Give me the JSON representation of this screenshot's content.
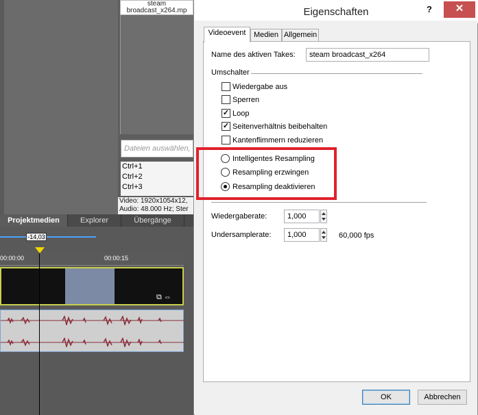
{
  "background": {
    "media_file_name_line1": "steam",
    "media_file_name_line2": "broadcast_x264.mp",
    "select_files_placeholder": "Dateien auswählen, ...",
    "shortcuts": [
      "Ctrl+1",
      "Ctrl+2",
      "Ctrl+3"
    ],
    "media_info_video": "Video: 1920x1054x12,",
    "media_info_audio": "Audio: 48.000 Hz; Ster",
    "tabs": [
      "Projektmedien",
      "Explorer",
      "Übergänge"
    ],
    "time_badge": "-14,03",
    "ruler_start": "00:00:00",
    "ruler_mark": "00:00:15"
  },
  "dialog": {
    "title": "Eigenschaften",
    "help_label": "?",
    "close_label": "✕",
    "tabs": [
      "Videoevent",
      "Medien",
      "Allgemein"
    ],
    "take_name_label": "Name des aktiven Takes:",
    "take_name_value": "steam broadcast_x264",
    "switches_heading": "Umschalter",
    "checkboxes": [
      {
        "label": "Wiedergabe aus",
        "checked": false
      },
      {
        "label": "Sperren",
        "checked": false
      },
      {
        "label": "Loop",
        "checked": true
      },
      {
        "label": "Seitenverhältnis beibehalten",
        "checked": true
      },
      {
        "label": "Kantenflimmern reduzieren",
        "checked": false
      }
    ],
    "radios": [
      {
        "label": "Intelligentes Resampling",
        "selected": false
      },
      {
        "label": "Resampling erzwingen",
        "selected": false
      },
      {
        "label": "Resampling deaktivieren",
        "selected": true
      }
    ],
    "playback_rate_label": "Wiedergaberate:",
    "playback_rate_value": "1,000",
    "undersample_rate_label": "Undersamplerate:",
    "undersample_rate_value": "1,000",
    "fps_text": "60,000 fps",
    "ok_label": "OK",
    "cancel_label": "Abbrechen"
  },
  "colors": {
    "highlight_box": "#e0202a",
    "close_button": "#c75050"
  }
}
